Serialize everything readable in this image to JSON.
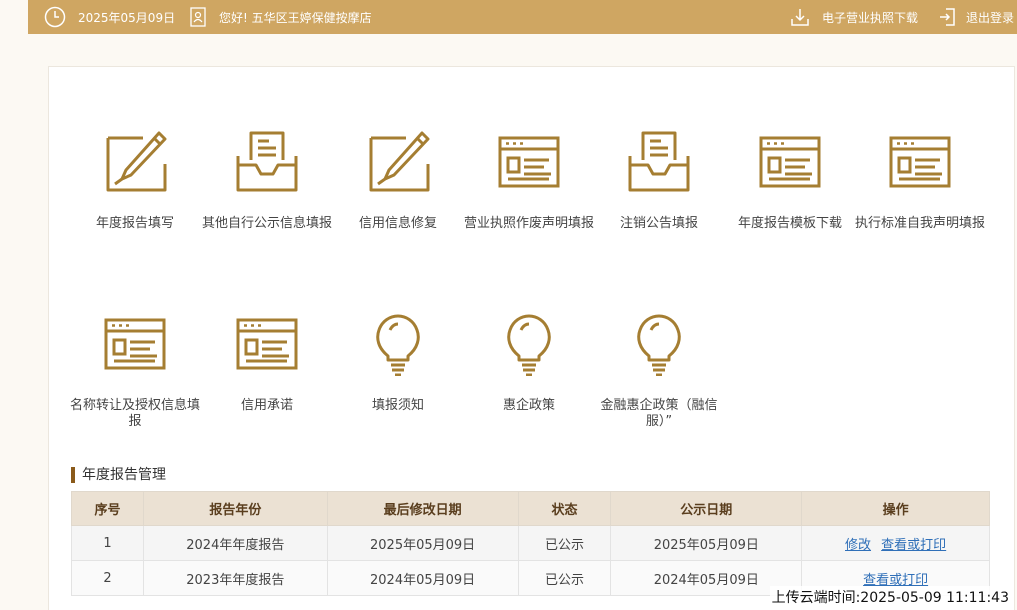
{
  "topbar": {
    "date": "2025年05月09日",
    "greeting": "您好! 五华区王婷保健按摩店",
    "download_label": "电子营业执照下载",
    "logout_label": "退出登录"
  },
  "tiles": [
    {
      "label": "年度报告填写",
      "icon": "edit-pen-icon"
    },
    {
      "label": "其他自行公示信息填报",
      "icon": "inbox-document-icon"
    },
    {
      "label": "信用信息修复",
      "icon": "edit-pen-icon"
    },
    {
      "label": "营业执照作废声明填报",
      "icon": "browser-form-icon"
    },
    {
      "label": "注销公告填报",
      "icon": "inbox-document-icon"
    },
    {
      "label": "年度报告模板下载",
      "icon": "browser-form-icon"
    },
    {
      "label": "执行标准自我声明填报",
      "icon": "browser-form-icon"
    },
    {
      "label": "名称转让及授权信息填报",
      "icon": "browser-form-icon"
    },
    {
      "label": "信用承诺",
      "icon": "browser-form-icon"
    },
    {
      "label": "填报须知",
      "icon": "lightbulb-icon"
    },
    {
      "label": "惠企政策",
      "icon": "lightbulb-icon"
    },
    {
      "label": "金融惠企政策（融信服）”",
      "icon": "lightbulb-icon"
    }
  ],
  "section": {
    "title": "年度报告管理"
  },
  "table": {
    "headers": [
      "序号",
      "报告年份",
      "最后修改日期",
      "状态",
      "公示日期",
      "操作"
    ],
    "rows": [
      {
        "no": "1",
        "year": "2024年年度报告",
        "modified": "2025年05月09日",
        "status": "已公示",
        "published": "2025年05月09日",
        "edit": "修改",
        "view": "查看或打印"
      },
      {
        "no": "2",
        "year": "2023年年度报告",
        "modified": "2024年05月09日",
        "status": "已公示",
        "published": "2024年05月09日",
        "view": "查看或打印"
      }
    ]
  },
  "watermark": "上传云端时间:2025-05-09 11:11:43",
  "colors": {
    "topbar": "#cfa662",
    "icon": "#a57e32",
    "header_row": "#ebe1d3",
    "link": "#2f6fb8"
  }
}
